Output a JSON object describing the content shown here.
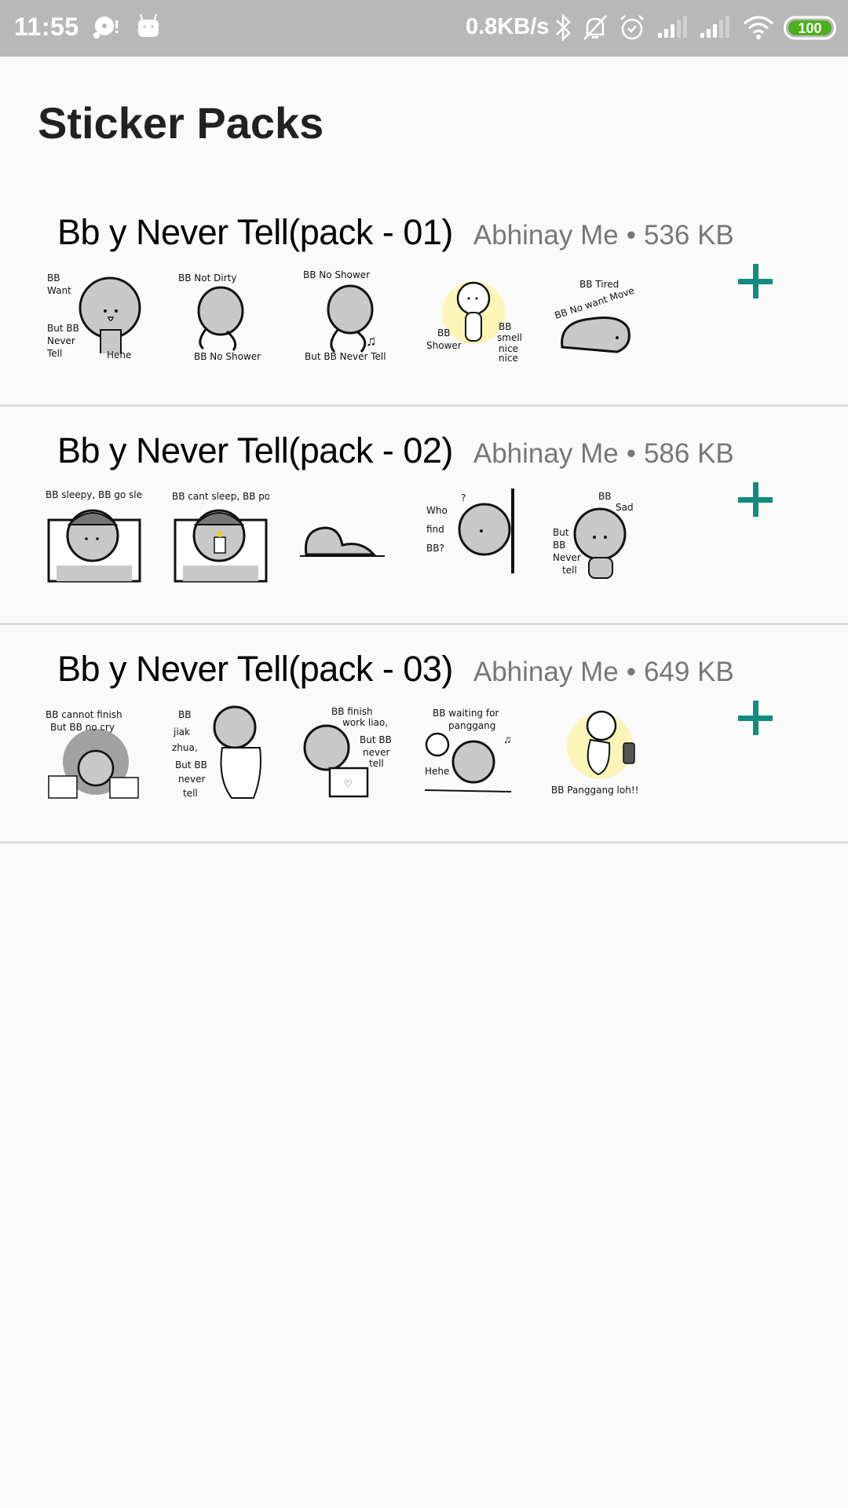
{
  "status_bar": {
    "time": "11:55",
    "network_speed": "0.8KB/s",
    "battery": "100",
    "icons": [
      "notification-app-icon",
      "android-icon",
      "bluetooth-icon",
      "silent-bell-icon",
      "alarm-icon",
      "signal-icon-sim1",
      "signal-icon-sim2",
      "wifi-icon",
      "battery-icon"
    ],
    "battery_color": "#4caf1c"
  },
  "page": {
    "title": "Sticker Packs"
  },
  "accent_color": "#128c7e",
  "packs": [
    {
      "name": "Bb y Never Tell(pack - 01)",
      "publisher": "Abhinay Me",
      "separator": "•",
      "size": "536 KB",
      "stickers": [
        {
          "caption": "BB Want / But BB Never Tell / Hehe"
        },
        {
          "caption": "BB Not Dirty / BB No Shower"
        },
        {
          "caption": "BB No Shower / But BB Never Tell"
        },
        {
          "caption": "BB Shower / BB smell nice nice"
        },
        {
          "caption": "BB Tired / BB No want Move"
        }
      ]
    },
    {
      "name": "Bb y Never Tell(pack - 02)",
      "publisher": "Abhinay Me",
      "separator": "•",
      "size": "586 KB",
      "stickers": [
        {
          "caption": "BB sleepy, BB go sleep"
        },
        {
          "caption": "BB cant sleep, BB poor thing"
        },
        {
          "caption": ""
        },
        {
          "caption": "Who find BB?"
        },
        {
          "caption": "BB Sad / But BB Never tell"
        }
      ]
    },
    {
      "name": "Bb y Never Tell(pack - 03)",
      "publisher": "Abhinay Me",
      "separator": "•",
      "size": "649 KB",
      "stickers": [
        {
          "caption": "BB cannot finish / But BB no cry"
        },
        {
          "caption": "BB jiak zhua, But BB never tell"
        },
        {
          "caption": "BB finish work liao, But BB never tell"
        },
        {
          "caption": "BB waiting for panggang / Hehe"
        },
        {
          "caption": "BB Panggang loh!!"
        }
      ]
    }
  ]
}
